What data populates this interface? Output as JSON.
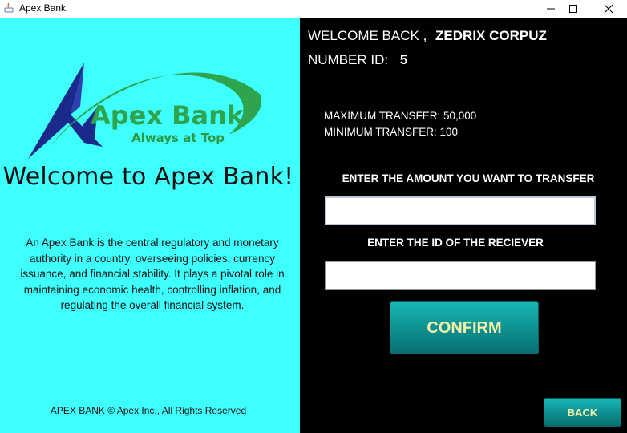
{
  "window": {
    "title": "Apex Bank"
  },
  "left_panel": {
    "logo": {
      "brand": "Apex Bank",
      "tagline": "Always at Top"
    },
    "welcome_heading": "Welcome to Apex Bank!",
    "description": "An Apex Bank is the central regulatory and monetary authority in a country, overseeing policies, currency issuance, and financial stability. It plays a pivotal role in maintaining economic health, controlling inflation, and regulating the overall financial system.",
    "footer": "APEX BANK © Apex Inc., All Rights Reserved"
  },
  "right_panel": {
    "welcome_label": "WELCOME BACK ,",
    "user_name": "ZEDRIX CORPUZ",
    "number_id_label": "NUMBER ID:",
    "number_id_value": "5",
    "max_transfer": "MAXIMUM TRANSFER: 50,000",
    "min_transfer": "MINIMUM TRANSFER: 100",
    "amount_prompt": "ENTER THE AMOUNT YOU WANT TO TRANSFER",
    "amount_value": "",
    "receiver_prompt": "ENTER THE ID OF THE RECIEVER",
    "receiver_value": "",
    "confirm_label": "CONFIRM",
    "back_label": "BACK"
  },
  "colors": {
    "left_bg": "#3ffffc",
    "right_bg": "#000000",
    "button_teal": "#0c8a8b",
    "button_text": "#f4f0a8",
    "logo_green": "#2ea44f",
    "logo_navy": "#1b2a8a"
  }
}
